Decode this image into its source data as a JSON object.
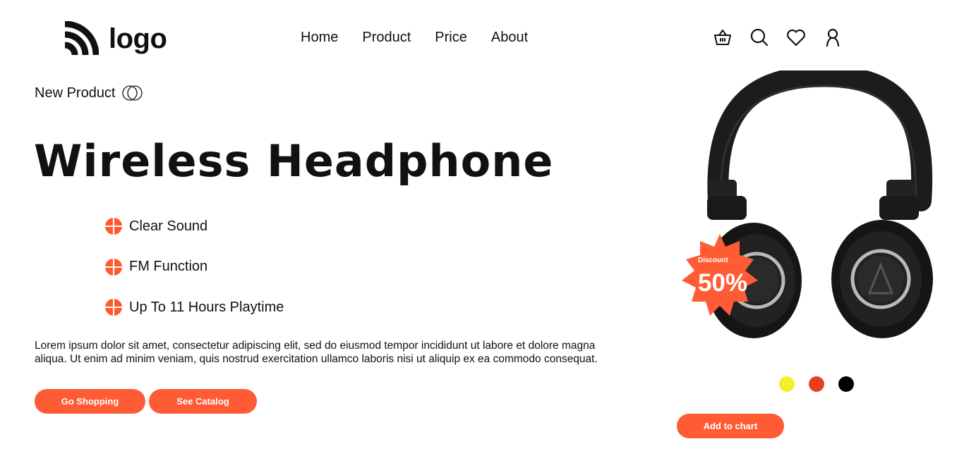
{
  "header": {
    "logo_text": "logo",
    "nav": [
      "Home",
      "Product",
      "Price",
      "About"
    ],
    "icons": [
      "basket-icon",
      "search-icon",
      "heart-icon",
      "user-icon"
    ]
  },
  "hero": {
    "tag": "New Product",
    "title": "Wireless Headphone",
    "features": [
      "Clear Sound",
      "FM Function",
      "Up To 11 Hours Playtime"
    ],
    "description": "Lorem ipsum dolor sit amet, consectetur adipiscing elit, sed do eiusmod tempor incididunt ut labore et dolore magna aliqua. Ut enim ad minim veniam, quis nostrud exercitation ullamco laboris nisi ut aliquip ex ea commodo consequat.",
    "buttons": {
      "shop": "Go Shopping",
      "catalog": "See Catalog"
    }
  },
  "product": {
    "discount_label": "Discount",
    "discount_value": "50%",
    "colors": [
      "#f5ef2a",
      "#e63e1f",
      "#000000"
    ],
    "add_to_cart": "Add to chart"
  },
  "theme": {
    "accent": "#ff5b35"
  }
}
